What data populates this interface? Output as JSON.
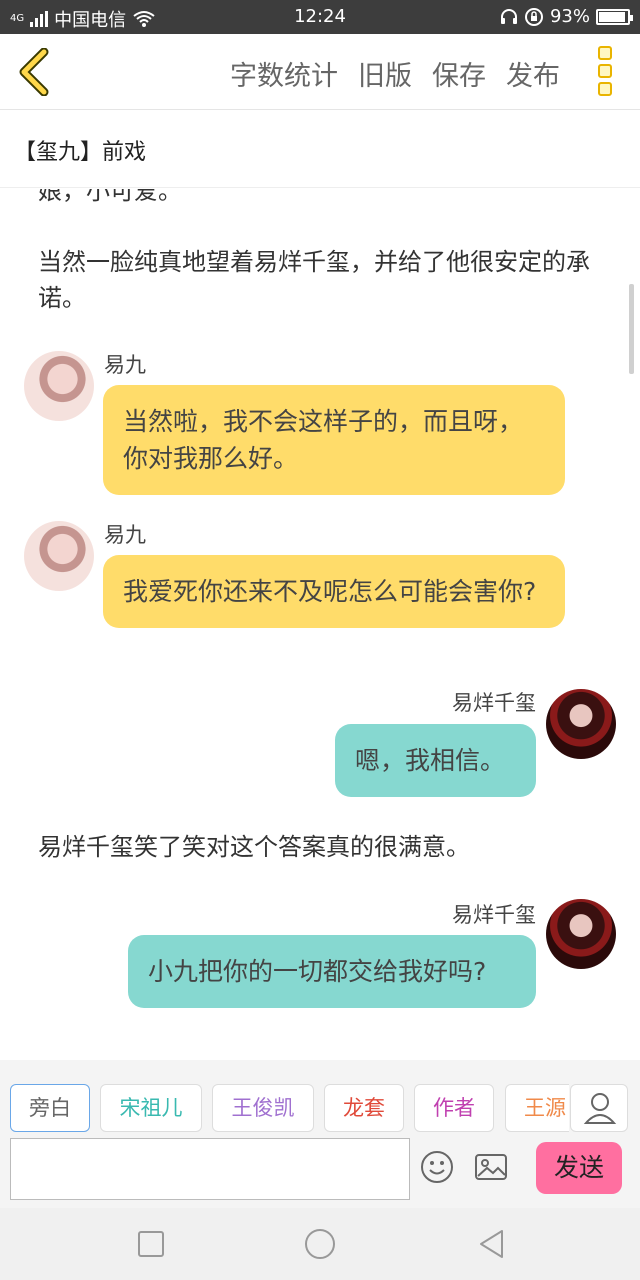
{
  "status_bar": {
    "network": "4G",
    "carrier": "中国电信",
    "time": "12:24",
    "battery_percent": "93%",
    "battery_level": 0.93
  },
  "header": {
    "back_icon": "chevron-left-icon",
    "actions": [
      "字数统计",
      "旧版",
      "保存",
      "发布"
    ],
    "more_icon": "more-vertical-icon"
  },
  "chapter_title": "【玺九】前戏",
  "content": {
    "narration_top_partial": "娘，小可爱。",
    "narration_1": "当然一脸纯真地望着易烊千玺，并给了他很安定的承诺。",
    "messages": [
      {
        "speaker": "易九",
        "text": "当然啦，我不会这样子的，而且呀，你对我那么好。"
      },
      {
        "speaker": "易九",
        "text": "我爱死你还来不及呢怎么可能会害你?"
      },
      {
        "speaker": "易烊千玺",
        "text": "嗯，我相信。"
      },
      {
        "speaker": "易烊千玺",
        "text": "小九把你的一切都交给我好吗?"
      }
    ],
    "narration_2": "易烊千玺笑了笑对这个答案真的很满意。"
  },
  "characters": [
    {
      "label": "旁白",
      "color": "#666666"
    },
    {
      "label": "宋祖儿",
      "color": "#39b9b0"
    },
    {
      "label": "王俊凯",
      "color": "#a070d0"
    },
    {
      "label": "龙套",
      "color": "#e04a3a"
    },
    {
      "label": "作者",
      "color": "#c040b0"
    },
    {
      "label": "王源",
      "color": "#f08a4a"
    }
  ],
  "composer": {
    "input_value": "",
    "send_label": "发送"
  }
}
